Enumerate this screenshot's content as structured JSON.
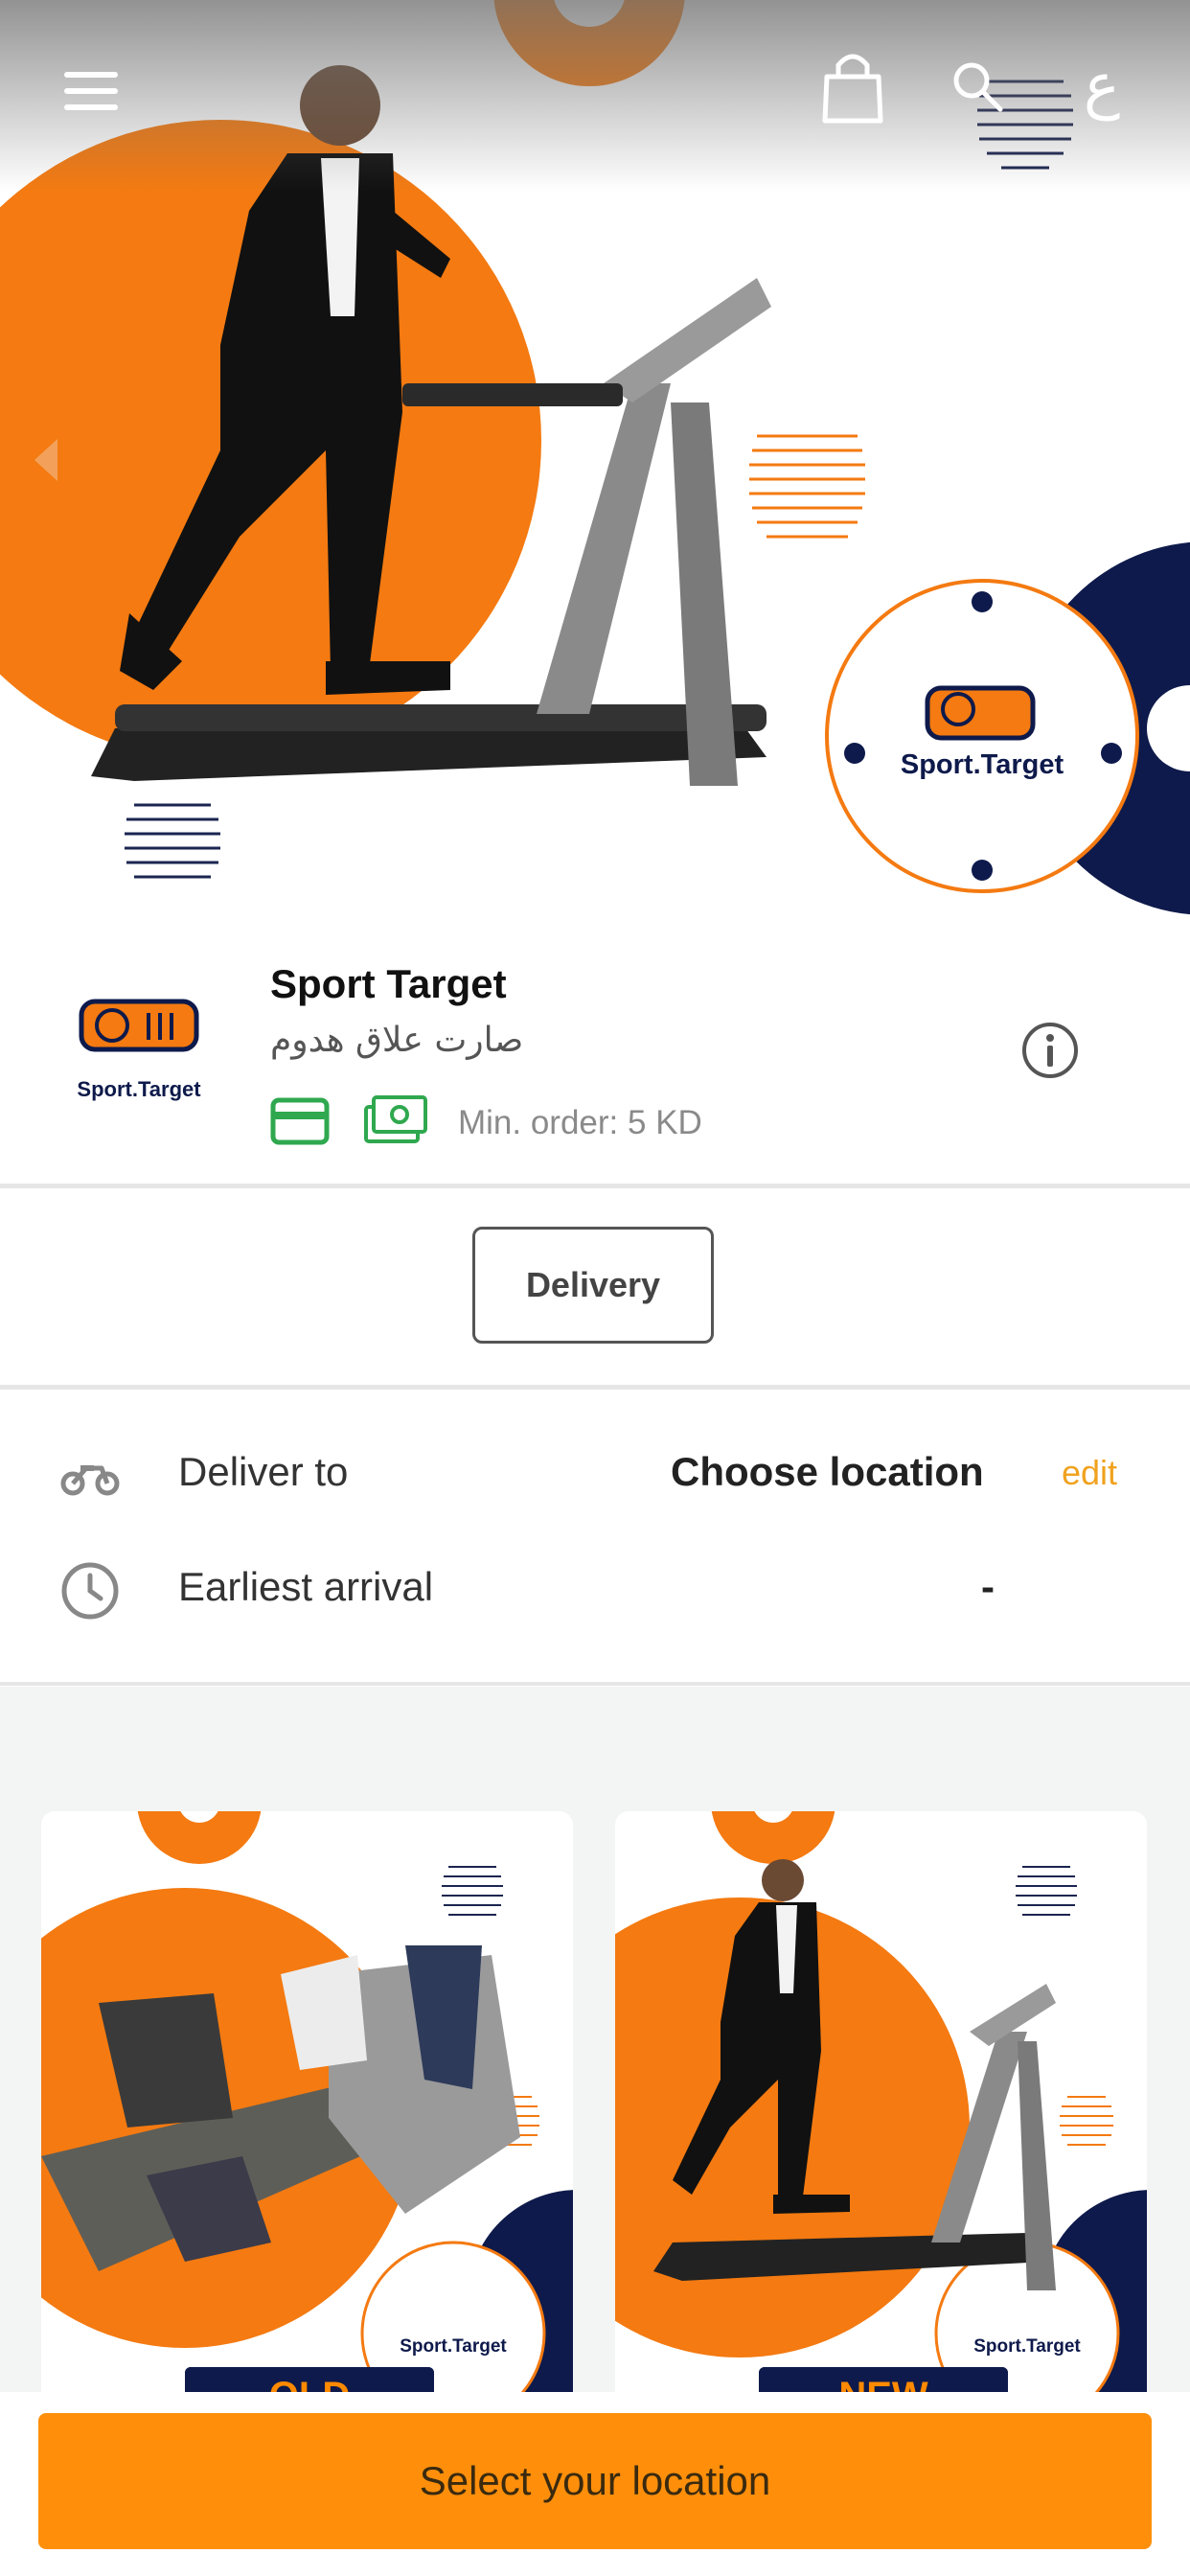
{
  "header": {
    "language_toggle": "ع",
    "icons": [
      "menu-icon",
      "shopping-bag-icon",
      "search-icon",
      "chevron-left-icon"
    ]
  },
  "banner": {
    "logo_text": "Sport.Target"
  },
  "store": {
    "name": "Sport Target",
    "name_ar": "صارت علاق هدوم",
    "min_order": "Min. order: 5 KD",
    "payment_icons": [
      "credit-card-icon",
      "cash-icon"
    ],
    "logo_text": "Sport.Target"
  },
  "order_mode": {
    "selected": "Delivery"
  },
  "delivery": {
    "deliver_to_label": "Deliver to",
    "deliver_to_value": "Choose location",
    "edit_label": "edit",
    "arrival_label": "Earliest arrival",
    "arrival_value": "-"
  },
  "products": [
    {
      "tag": "OLD",
      "logo_text": "Sport.Target"
    },
    {
      "tag": "NEW",
      "logo_text": "Sport.Target"
    }
  ],
  "cta": {
    "label": "Select your location"
  },
  "colors": {
    "brand_orange": "#ff8f0b",
    "navy": "#0e1a4b",
    "accent_edit": "#f0a21f",
    "pay_green": "#2fa84f"
  }
}
